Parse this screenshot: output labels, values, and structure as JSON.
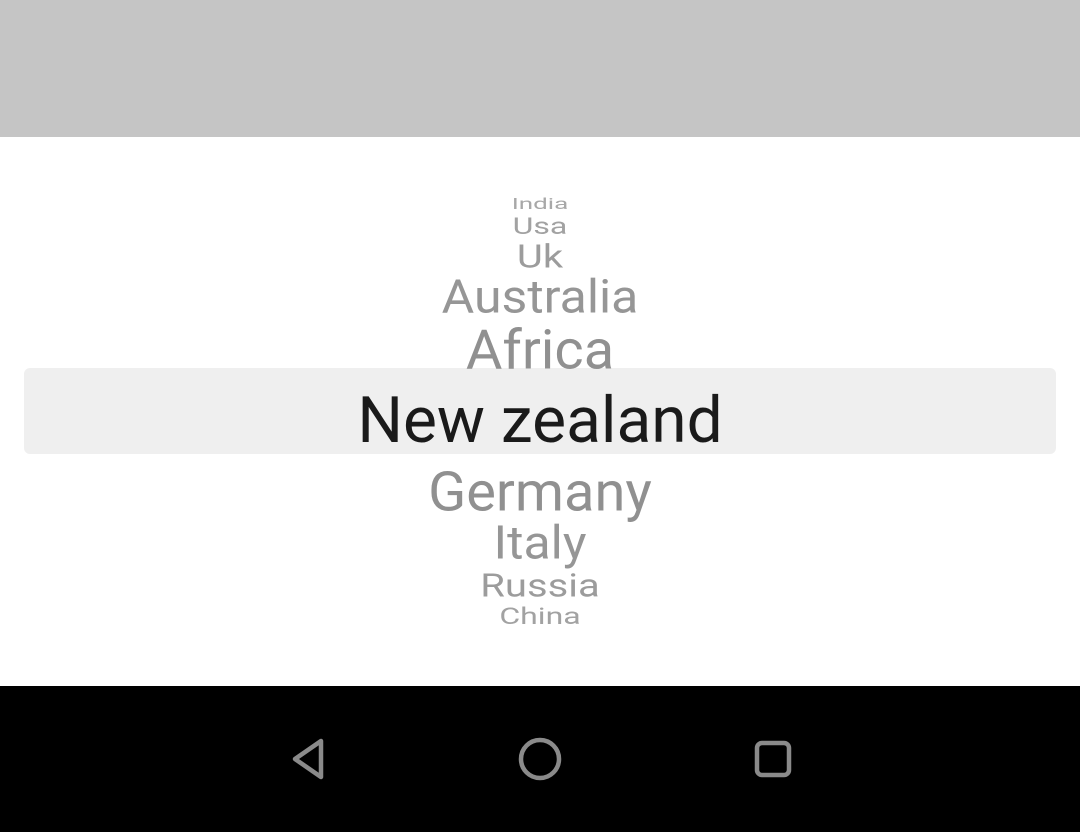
{
  "picker": {
    "items": [
      "India",
      "Usa",
      "Uk",
      "Australia",
      "Africa",
      "New zealand",
      "Germany",
      "Italy",
      "Russia",
      "China"
    ],
    "selected_index": 5
  },
  "nav": {
    "back": "back",
    "home": "home",
    "recent": "recent"
  }
}
